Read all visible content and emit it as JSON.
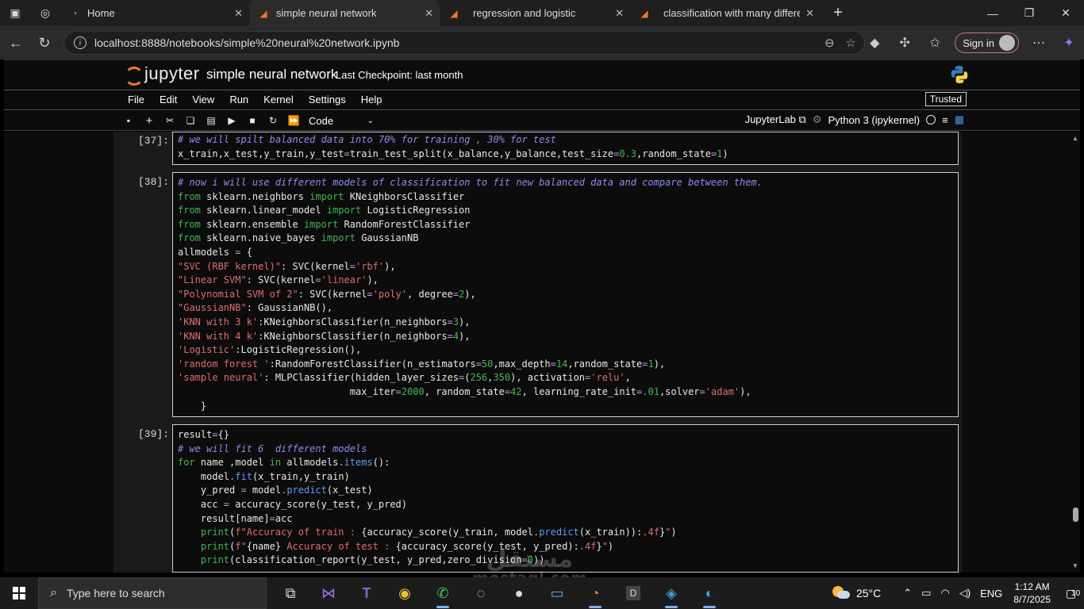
{
  "browser": {
    "tabs": [
      {
        "label": "Home",
        "active": false
      },
      {
        "label": "simple neural network",
        "active": true
      },
      {
        "label": "regression and logistic",
        "active": false
      },
      {
        "label": "classification with many different",
        "active": false
      }
    ],
    "url": "localhost:8888/notebooks/simple%20neural%20network.ipynb",
    "signin_label": "Sign in"
  },
  "jupyter": {
    "logo_text": "jupyter",
    "notebook_title": "simple neural network",
    "checkpoint": "Last Checkpoint: last month",
    "menu": [
      "File",
      "Edit",
      "View",
      "Run",
      "Kernel",
      "Settings",
      "Help"
    ],
    "trusted": "Trusted",
    "cell_type": "Code",
    "jupyterlab_link": "JupyterLab",
    "kernel": "Python 3 (ipykernel)"
  },
  "cells": [
    {
      "prompt": "[37]:",
      "lines": [
        [
          [
            "c",
            "# we will spilt balanced data into 70% for training , 30% for test"
          ]
        ],
        [
          [
            "p",
            "x_train,x_test,y_train,y_test"
          ],
          [
            "o",
            "="
          ],
          [
            "p",
            "train_test_split(x_balance,y_balance,test_size"
          ],
          [
            "o",
            "="
          ],
          [
            "n",
            "0.3"
          ],
          [
            "p",
            ",random_state"
          ],
          [
            "o",
            "="
          ],
          [
            "n",
            "1"
          ],
          [
            "p",
            ")"
          ]
        ]
      ]
    },
    {
      "prompt": "[38]:",
      "lines": [
        [
          [
            "c",
            "# now i will use different models of classification to fit new balanced data and compare between them."
          ]
        ],
        [
          [
            "k",
            "from"
          ],
          [
            "p",
            " sklearn.neighbors "
          ],
          [
            "k",
            "import"
          ],
          [
            "p",
            " KNeighborsClassifier"
          ]
        ],
        [
          [
            "k",
            "from"
          ],
          [
            "p",
            " sklearn.linear_model "
          ],
          [
            "k",
            "import"
          ],
          [
            "p",
            " LogisticRegression"
          ]
        ],
        [
          [
            "k",
            "from"
          ],
          [
            "p",
            " sklearn.ensemble "
          ],
          [
            "k",
            "import"
          ],
          [
            "p",
            " RandomForestClassifier"
          ]
        ],
        [
          [
            "k",
            "from"
          ],
          [
            "p",
            " sklearn.naive_bayes "
          ],
          [
            "k",
            "import"
          ],
          [
            "p",
            " GaussianNB"
          ]
        ],
        [
          [
            "p",
            "allmodels "
          ],
          [
            "o",
            "="
          ],
          [
            "p",
            " {"
          ]
        ],
        [
          [
            "s",
            "\"SVC (RBF kernel)\""
          ],
          [
            "p",
            ": SVC(kernel"
          ],
          [
            "o",
            "="
          ],
          [
            "s",
            "'rbf'"
          ],
          [
            "p",
            "),"
          ]
        ],
        [
          [
            "s",
            "\"Linear SVM\""
          ],
          [
            "p",
            ": SVC(kernel"
          ],
          [
            "o",
            "="
          ],
          [
            "s",
            "'linear'"
          ],
          [
            "p",
            "),"
          ]
        ],
        [
          [
            "s",
            "\"Polynomial SVM of 2\""
          ],
          [
            "p",
            ": SVC(kernel"
          ],
          [
            "o",
            "="
          ],
          [
            "s",
            "'poly'"
          ],
          [
            "p",
            ", degree"
          ],
          [
            "o",
            "="
          ],
          [
            "n",
            "2"
          ],
          [
            "p",
            "),"
          ]
        ],
        [
          [
            "s",
            "\"GaussianNB\""
          ],
          [
            "p",
            ": GaussianNB(),"
          ]
        ],
        [
          [
            "s",
            "'KNN with 3 k'"
          ],
          [
            "p",
            ":KNeighborsClassifier(n_neighbors"
          ],
          [
            "o",
            "="
          ],
          [
            "n",
            "3"
          ],
          [
            "p",
            "),"
          ]
        ],
        [
          [
            "s",
            "'KNN with 4 k'"
          ],
          [
            "p",
            ":KNeighborsClassifier(n_neighbors"
          ],
          [
            "o",
            "="
          ],
          [
            "n",
            "4"
          ],
          [
            "p",
            "),"
          ]
        ],
        [
          [
            "s",
            "'Logistic'"
          ],
          [
            "p",
            ":LogisticRegression(),"
          ]
        ],
        [
          [
            "s",
            "'random forest '"
          ],
          [
            "p",
            ":RandomForestClassifier(n_estimators"
          ],
          [
            "o",
            "="
          ],
          [
            "n",
            "50"
          ],
          [
            "p",
            ",max_depth"
          ],
          [
            "o",
            "="
          ],
          [
            "n",
            "14"
          ],
          [
            "p",
            ",random_state"
          ],
          [
            "o",
            "="
          ],
          [
            "n",
            "1"
          ],
          [
            "p",
            "),"
          ]
        ],
        [
          [
            "s",
            "'sample neural'"
          ],
          [
            "p",
            ": MLPClassifier(hidden_layer_sizes"
          ],
          [
            "o",
            "="
          ],
          [
            "p",
            "("
          ],
          [
            "n",
            "256"
          ],
          [
            "p",
            ","
          ],
          [
            "n",
            "350"
          ],
          [
            "p",
            "), activation"
          ],
          [
            "o",
            "="
          ],
          [
            "s",
            "'relu'"
          ],
          [
            "p",
            ","
          ]
        ],
        [
          [
            "p",
            "                              max_iter"
          ],
          [
            "o",
            "="
          ],
          [
            "n",
            "2000"
          ],
          [
            "p",
            ", random_state"
          ],
          [
            "o",
            "="
          ],
          [
            "n",
            "42"
          ],
          [
            "p",
            ", learning_rate_init"
          ],
          [
            "o",
            "="
          ],
          [
            "n",
            ".01"
          ],
          [
            "p",
            ",solver"
          ],
          [
            "o",
            "="
          ],
          [
            "s",
            "'adam'"
          ],
          [
            "p",
            "),"
          ]
        ],
        [
          [
            "p",
            "    }"
          ]
        ]
      ]
    },
    {
      "prompt": "[39]:",
      "lines": [
        [
          [
            "p",
            "result"
          ],
          [
            "o",
            "="
          ],
          [
            "p",
            "{}"
          ]
        ],
        [
          [
            "c",
            "# we will fit 6  different models"
          ]
        ],
        [
          [
            "k",
            "for"
          ],
          [
            "p",
            " name ,model "
          ],
          [
            "k",
            "in"
          ],
          [
            "p",
            " allmodels"
          ],
          [
            "o",
            "."
          ],
          [
            "f",
            "items"
          ],
          [
            "p",
            "():"
          ]
        ],
        [
          [
            "p",
            "    model"
          ],
          [
            "o",
            "."
          ],
          [
            "f",
            "fit"
          ],
          [
            "p",
            "(x_train,y_train)"
          ]
        ],
        [
          [
            "p",
            "    y_pred "
          ],
          [
            "o",
            "="
          ],
          [
            "p",
            " model"
          ],
          [
            "o",
            "."
          ],
          [
            "f",
            "predict"
          ],
          [
            "p",
            "(x_test)"
          ]
        ],
        [
          [
            "p",
            "    acc "
          ],
          [
            "o",
            "="
          ],
          [
            "p",
            " accuracy_score(y_test, y_pred)"
          ]
        ],
        [
          [
            "p",
            "    result[name]"
          ],
          [
            "o",
            "="
          ],
          [
            "p",
            "acc"
          ]
        ],
        [
          [
            "p",
            "    "
          ],
          [
            "k",
            "print"
          ],
          [
            "p",
            "("
          ],
          [
            "s",
            "f\"Accuracy of train : "
          ],
          [
            "p",
            "{accuracy_score(y_train, model"
          ],
          [
            "o",
            "."
          ],
          [
            "f",
            "predict"
          ],
          [
            "p",
            "(x_train)):"
          ],
          [
            "s",
            ".4f"
          ],
          [
            "p",
            "}"
          ],
          [
            "s",
            "\""
          ],
          [
            "p",
            ")"
          ]
        ],
        [
          [
            "p",
            "    "
          ],
          [
            "k",
            "print"
          ],
          [
            "p",
            "("
          ],
          [
            "s",
            "f\""
          ],
          [
            "p",
            "{name}"
          ],
          [
            "s",
            " Accuracy of test : "
          ],
          [
            "p",
            "{accuracy_score(y_test, y_pred):"
          ],
          [
            "s",
            ".4f"
          ],
          [
            "p",
            "}"
          ],
          [
            "s",
            "\""
          ],
          [
            "p",
            ")"
          ]
        ],
        [
          [
            "p",
            "    "
          ],
          [
            "k",
            "print"
          ],
          [
            "p",
            "(classification_report(y_test, y_pred,zero_division"
          ],
          [
            "o",
            "="
          ],
          [
            "n",
            "0"
          ],
          [
            "p",
            "))"
          ]
        ]
      ]
    }
  ],
  "taskbar": {
    "search_placeholder": "Type here to search",
    "apps": [
      "task-view",
      "visual-studio",
      "teams",
      "chrome",
      "whatsapp",
      "obs",
      "github",
      "remote-desktop",
      "jupyter-app",
      "d-app",
      "chat-app",
      "edge"
    ],
    "d_app_label": "D",
    "weather": "25°C",
    "language": "ENG",
    "time": "1:12 AM",
    "date": "8/7/2025",
    "notifications": "10"
  },
  "watermark": {
    "line1": "مستقل",
    "line2": "mostaql.com"
  }
}
